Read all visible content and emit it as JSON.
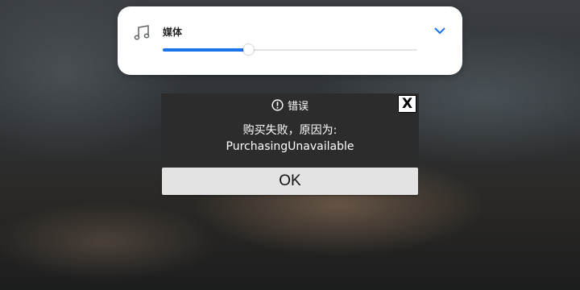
{
  "volume_panel": {
    "stream_label": "媒体",
    "volume_level": 0.34,
    "icon": "music-note-icon",
    "expand_icon": "chevron-down-icon",
    "accent_color": "#1a73e8"
  },
  "error_dialog": {
    "title": "错误",
    "title_icon": "alert-circle-icon",
    "close_label": "X",
    "message_line1": "购买失败，原因为:",
    "message_line2": "PurchasingUnavailable",
    "ok_label": "OK"
  }
}
